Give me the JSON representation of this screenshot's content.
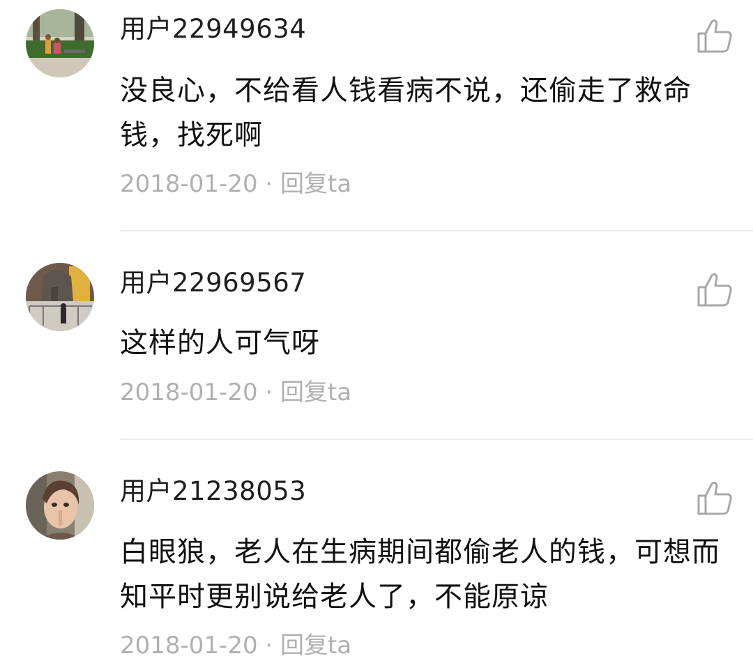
{
  "comments": [
    {
      "username": "用户22949634",
      "content": "没良心，不给看人钱看病不说，还偷走了救命钱，找死啊",
      "date": "2018-01-20",
      "separator": "·",
      "reply_label": "回复ta",
      "avatar": "avatar-person-outdoor-photo",
      "like_icon": "thumbs-up-icon"
    },
    {
      "username": "用户22969567",
      "content": "这样的人可气呀",
      "date": "2018-01-20",
      "separator": "·",
      "reply_label": "回复ta",
      "avatar": "avatar-elephant-statue-photo",
      "like_icon": "thumbs-up-icon"
    },
    {
      "username": "用户21238053",
      "content": "白眼狼，老人在生病期间都偷老人的钱，可想而知平时更别说给老人了，不能原谅",
      "date": "2018-01-20",
      "separator": "·",
      "reply_label": "回复ta",
      "avatar": "avatar-child-photo",
      "like_icon": "thumbs-up-icon"
    }
  ],
  "colors": {
    "meta_text": "#b0b0b0",
    "divider": "#ececec",
    "icon_stroke": "#a8a8a8"
  }
}
